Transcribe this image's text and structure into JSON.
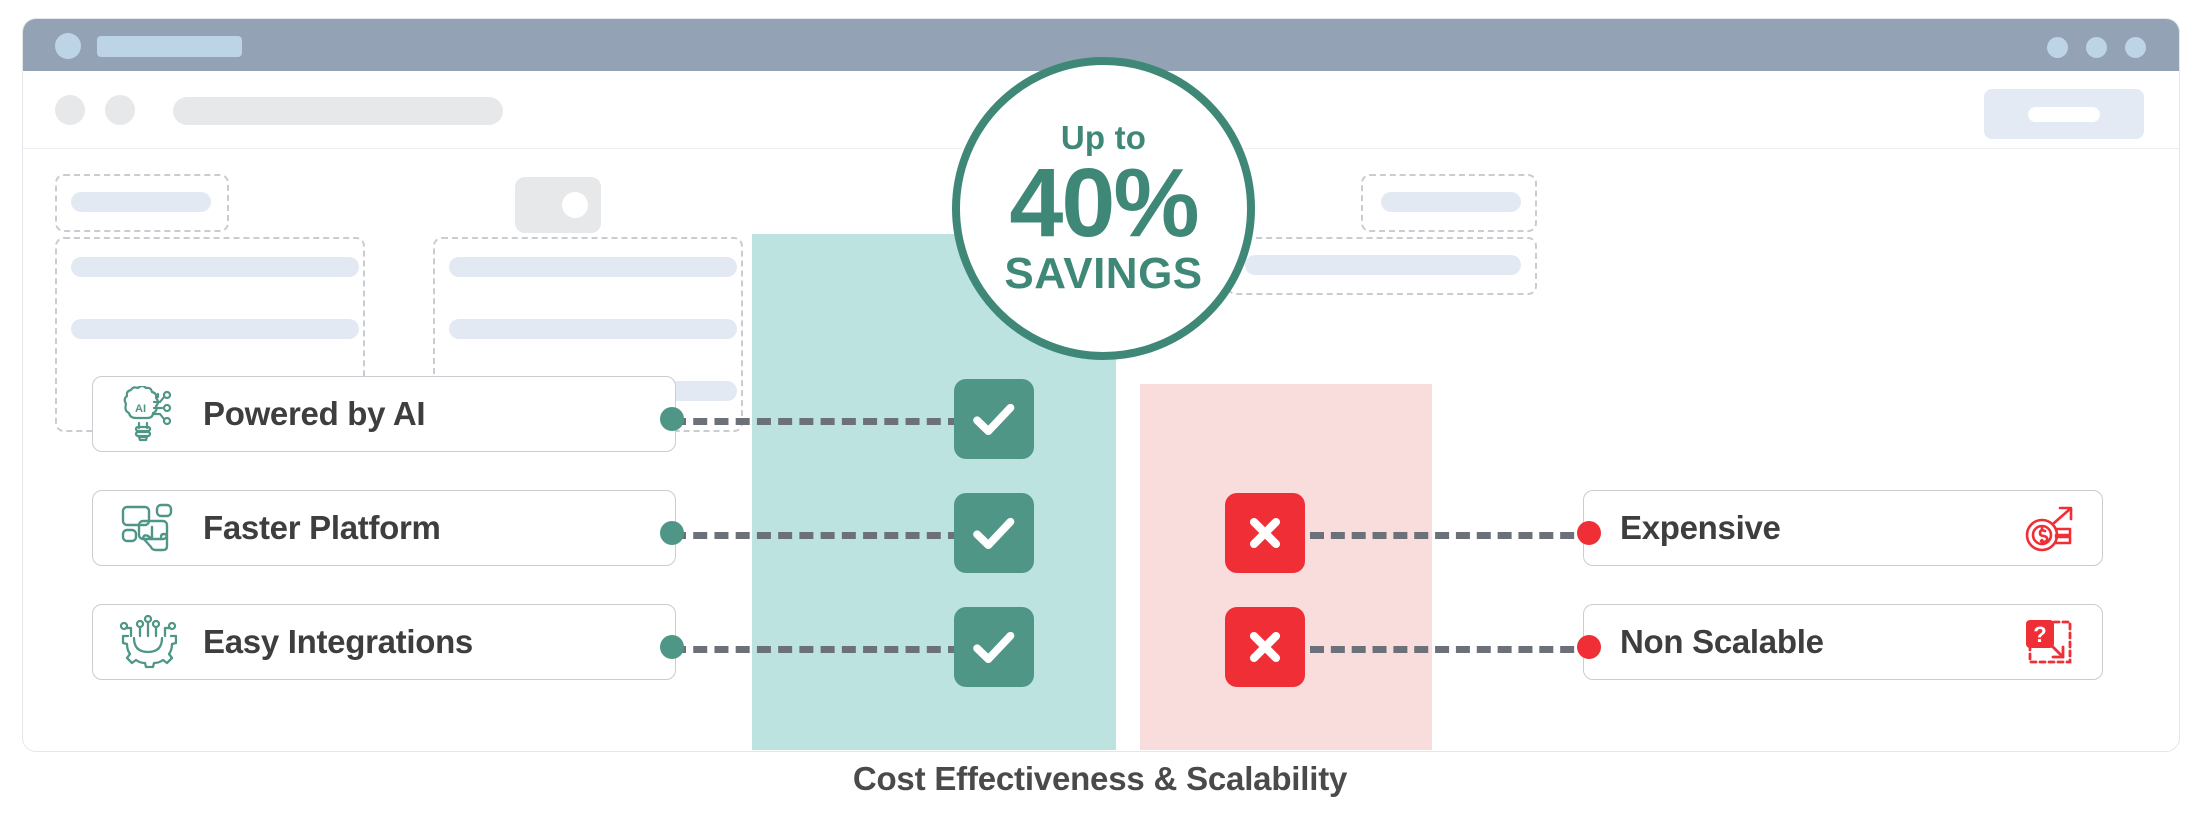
{
  "window": {
    "title_bar": {
      "logo_icon": "circle-logo-icon",
      "title_placeholder_icon": "title-placeholder-bar",
      "controls": [
        "window-dot-1",
        "window-dot-2",
        "window-dot-3"
      ]
    },
    "toolbar": {
      "nav_back_icon": "nav-back-circle-icon",
      "nav_forward_icon": "nav-forward-circle-icon",
      "address_bar_placeholder": "address-bar-placeholder",
      "action_button_placeholder": "toolbar-action-button"
    }
  },
  "badge": {
    "prefix": "Up to",
    "value": "40%",
    "suffix": "SAVINGS",
    "color": "#3f8877"
  },
  "columns": {
    "pro": {
      "name": "pro-column",
      "color": "#bde3e1"
    },
    "con": {
      "name": "con-column",
      "color": "#f9dddd"
    }
  },
  "pros": [
    {
      "label": "Powered by AI",
      "icon": "ai-bulb-icon",
      "mark": "check-mark-icon"
    },
    {
      "label": "Faster Platform",
      "icon": "platform-click-icon",
      "mark": "check-mark-icon"
    },
    {
      "label": "Easy Integrations",
      "icon": "circuit-gear-icon",
      "mark": "check-mark-icon"
    }
  ],
  "cons": [
    {
      "label": "Expensive",
      "icon": "cost-rising-icon",
      "mark": "cross-mark-icon"
    },
    {
      "label": "Non Scalable",
      "icon": "non-scalable-icon",
      "mark": "cross-mark-icon"
    }
  ],
  "caption": "Cost Effectiveness & Scalability",
  "colors": {
    "teal_accent": "#4f9687",
    "teal_dark": "#3f8877",
    "teal_light": "#bde3e1",
    "red_accent": "#ef2f35",
    "red_light": "#f9dddd",
    "text_dark": "#3e3e3e",
    "title_bar": "#93a2b5"
  }
}
